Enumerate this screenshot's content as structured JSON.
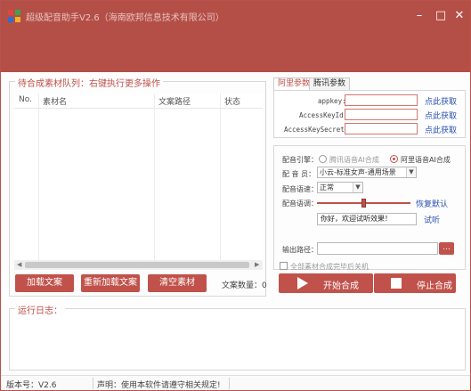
{
  "window": {
    "title": "超级配音助手V2.6（海南欧邦信息技术有限公司）",
    "controls": {
      "minimize": "–",
      "maximize": "□",
      "close": "✕"
    }
  },
  "queue": {
    "group_title": "待合成素材队列：右键执行更多操作",
    "columns": [
      "No.",
      "素材名",
      "文案路径",
      "状态"
    ],
    "rows": [],
    "buttons": {
      "load": "加载文案",
      "reload": "重新加载文案",
      "clear": "清空素材"
    },
    "count_label": "文案数量：",
    "count_value": "0"
  },
  "tabs": [
    {
      "label": "阿里参数",
      "active": true
    },
    {
      "label": "腾讯参数",
      "active": false
    }
  ],
  "ali": {
    "appkey_label": "appkey:",
    "keyid_label": "AccessKeyId:",
    "keysecret_label": "AccessKeySecret:",
    "appkey_value": "",
    "keyid_value": "",
    "keysecret_value": "",
    "link_label": "点此获取"
  },
  "voice": {
    "engine_label": "配音引擎：",
    "engines": [
      {
        "label": "腾讯语音AI合成",
        "selected": false
      },
      {
        "label": "阿里语音AI合成",
        "selected": true
      }
    ],
    "voice_label": "配 音 员：",
    "voice_value": "小云-标准女声-通用场景",
    "speed_label": "配音语速：",
    "speed_value": "正常",
    "tone_label": "配音语调：",
    "tone_level": 0.5,
    "reset_label": "恢复默认",
    "test_text": "你好，欢迎试听效果！",
    "test_label": "试听"
  },
  "output": {
    "path_label": "输出路径：",
    "path_value": "",
    "browse_label": "...",
    "shutdown_label": "全部素材合成完毕后关机",
    "start_label": "开始合成",
    "stop_label": "停止合成"
  },
  "log": {
    "group_title": "运行日志："
  },
  "statusbar": {
    "version": "版本号：V2.6",
    "notice": "声明：使用本软件请遵守相关规定!"
  },
  "colors": {
    "brand": "#b44f48",
    "accent": "#c0524b",
    "link": "#2a4fb0"
  },
  "icons": {
    "app": "app-logo-icon",
    "start": "play-icon",
    "stop": "stop-icon"
  }
}
